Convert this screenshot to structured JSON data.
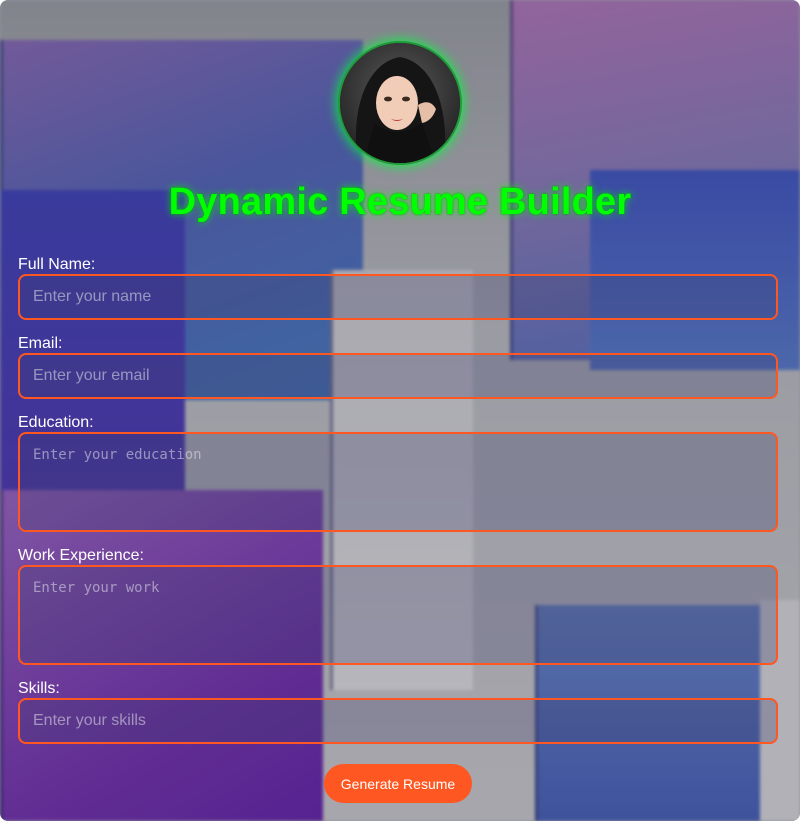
{
  "header": {
    "title": "Dynamic Resume Builder"
  },
  "form": {
    "full_name": {
      "label": "Full Name:",
      "placeholder": "Enter your name",
      "value": ""
    },
    "email": {
      "label": "Email:",
      "placeholder": "Enter your email",
      "value": ""
    },
    "education": {
      "label": "Education:",
      "placeholder": "Enter your education",
      "value": ""
    },
    "work_experience": {
      "label": "Work Experience:",
      "placeholder": "Enter your work",
      "value": ""
    },
    "skills": {
      "label": "Skills:",
      "placeholder": "Enter your skills",
      "value": ""
    },
    "submit_label": "Generate Resume"
  },
  "colors": {
    "accent": "#ff5722",
    "title": "#00ff00",
    "avatar_glow": "#00ff3c"
  },
  "icons": {
    "avatar": "profile-photo"
  }
}
